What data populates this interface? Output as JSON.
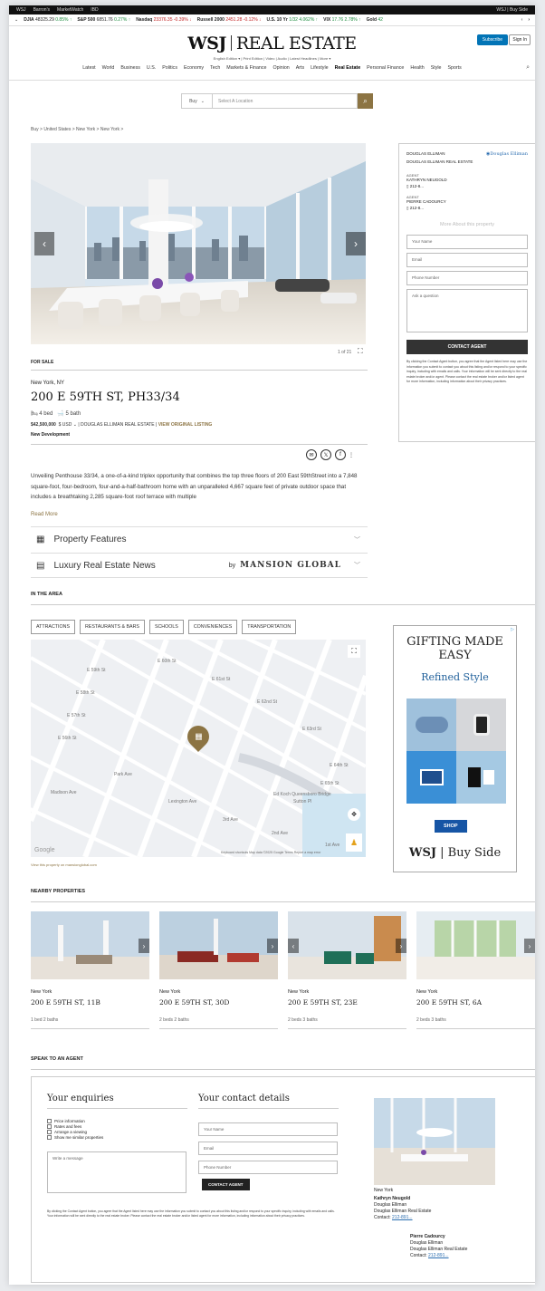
{
  "topbar": {
    "links": [
      "WSJ",
      "Barron's",
      "MarketWatch",
      "IBD"
    ],
    "right": "WSJ | Buy Side"
  },
  "ticker": [
    {
      "name": "DJIA",
      "value": "48325.29",
      "change": "0.85%",
      "dir": "up"
    },
    {
      "name": "S&P 500",
      "value": "6851.76",
      "change": "0.27%",
      "dir": "up"
    },
    {
      "name": "Nasdaq",
      "value": "23376.35",
      "change": "-0.39%",
      "dir": "down"
    },
    {
      "name": "Russell 2000",
      "value": "2451.28",
      "change": "-0.12%",
      "dir": "down"
    },
    {
      "name": "U.S. 10 Yr",
      "value": "1/32",
      "change": "4.062%",
      "dir": "up"
    },
    {
      "name": "VIX",
      "value": "17.76",
      "change": "2.78%",
      "dir": "up"
    },
    {
      "name": "Gold",
      "value": "42",
      "change": "",
      "dir": "up"
    }
  ],
  "masthead": {
    "logo_left": "WSJ",
    "logo_right": "REAL ESTATE",
    "subnav": "English Edition ▾  |  Print Edition  |  Video  |  Audio  |  Latest Headlines  |  More ▾",
    "subscribe": "Subscribe",
    "signin": "Sign In"
  },
  "nav": [
    "Latest",
    "World",
    "Business",
    "U.S.",
    "Politics",
    "Economy",
    "Tech",
    "Markets & Finance",
    "Opinion",
    "Arts",
    "Lifestyle",
    "Real Estate",
    "Personal Finance",
    "Health",
    "Style",
    "Sports"
  ],
  "search": {
    "mode": "Buy",
    "placeholder": "Select A Location"
  },
  "breadcrumb": "Buy  >  United States  >  New York  >  New York  >",
  "listing": {
    "counter": "1 of 21",
    "status": "FOR SALE",
    "city": "New York, NY",
    "address": "200 E 59TH ST, PH33/34",
    "beds": "4 bed",
    "baths": "5 bath",
    "price": "$42,500,000",
    "currency": "$ USD",
    "broker": "| DOUGLAS ELLIMAN REAL ESTATE |",
    "view_link": "VIEW ORIGINAL LISTING",
    "tag": "New Development",
    "description": "Unveiling Penthouse 33/34, a one-of-a-kind triplex opportunity that combines the top three floors of 200 East 59thStreet into a 7,848 square-foot, four-bedroom, four-and-a-half-bathroom home with an unparalleled 4,667 square feet of private outdoor space that includes a breathtaking 2,285 square-foot roof terrace with multiple",
    "read_more": "Read More",
    "features": "Property Features",
    "news": "Luxury Real Estate News",
    "by": "by",
    "partner": "MANSION GLOBAL"
  },
  "agent_box": {
    "brokerage": "DOUGLAS ELLIMAN",
    "brokerage_full": "DOUGLAS ELLIMAN REAL ESTATE",
    "brand": "Douglas Elliman",
    "agent_label": "AGENT",
    "agent1": "KATHRYN NEUGOLD",
    "phone1": "212-8...",
    "agent2": "PIERRE CADOURCY",
    "phone2": "212-8...",
    "more": "More About this property",
    "name_ph": "Your Name",
    "email_ph": "Email",
    "phone_ph": "Phone Number",
    "question_ph": "Ask a question",
    "button": "CONTACT AGENT",
    "disclaimer": "By clicking the Contact Agent button, you agree that the Agent listed here may use the information you submit to contact you about this listing and/or respond to your specific inquiry, including with emails and calls. Your information will be sent directly to the real estate broker and/or agent. Please contact the real estate broker and/or listed agent for more information, including information about their privacy practices."
  },
  "area": {
    "title": "IN THE AREA",
    "tabs": [
      "ATTRACTIONS",
      "RESTAURANTS & BARS",
      "SCHOOLS",
      "CONVENIENCES",
      "TRANSPORTATION"
    ],
    "streets": [
      "E 59th St",
      "E 58th St",
      "E 57th St",
      "E 56th St",
      "E 60th St",
      "E 61st St",
      "E 62nd St",
      "E 63rd St",
      "Park Ave",
      "Lexington Ave",
      "3rd Ave",
      "2nd Ave",
      "Madison Ave",
      "E 64th St",
      "E 65th St",
      "1st Ave",
      "Sutton Pl",
      "Ed Koch Queensboro Bridge"
    ],
    "map_footer": "Keyboard shortcuts   Map data ©2025 Google   Terms   Report a map error",
    "google": "Google",
    "view_link": "View this property on mansionglobal.com"
  },
  "ad": {
    "headline": "GIFTING MADE EASY",
    "sub": "Refined Style",
    "shop": "SHOP",
    "brand_left": "WSJ",
    "brand_right": "Buy Side"
  },
  "nearby": {
    "title": "NEARBY PROPERTIES",
    "items": [
      {
        "city": "New York",
        "address": "200 E 59TH ST, 11B",
        "info": "1 bed   2 baths"
      },
      {
        "city": "New York",
        "address": "200 E 59TH ST, 30D",
        "info": "2 beds   2 baths"
      },
      {
        "city": "New York",
        "address": "200 E 59TH ST, 23E",
        "info": "2 beds   3 baths"
      },
      {
        "city": "New York",
        "address": "200 E 59TH ST, 6A",
        "info": "2 beds   3 baths"
      }
    ]
  },
  "speak": {
    "title": "SPEAK TO AN AGENT",
    "enquiries": "Your enquiries",
    "contact": "Your contact details",
    "options": [
      "Price information",
      "Rates and fees",
      "Arrange a viewing",
      "Show me similar properties"
    ],
    "message_ph": "Write a message",
    "name_ph": "Your Name",
    "email_ph": "Email",
    "phone_ph": "Phone Number",
    "button": "CONTACT AGENT",
    "disclaimer": "By clicking the Contact Agent button, you agree that the Agent listed here may use the information you submit to contact you about this listing and/or respond to your specific inquiry, including with emails and calls. Your information will be sent directly to the real estate broker. Please contact the real estate broker and/or listed agent for more information, including information about their privacy practices.",
    "city": "New York",
    "agent1": {
      "name": "Kathryn Neugold",
      "co1": "Douglas Elliman",
      "co2": "Douglas Elliman Real Estate",
      "contact": "Contact:",
      "phone": "212-891..."
    },
    "agent2": {
      "name": "Pierre Cadourcy",
      "co1": "Douglas Elliman",
      "co2": "Douglas Elliman Real Estate",
      "contact": "Contact:",
      "phone": "212-891..."
    }
  }
}
